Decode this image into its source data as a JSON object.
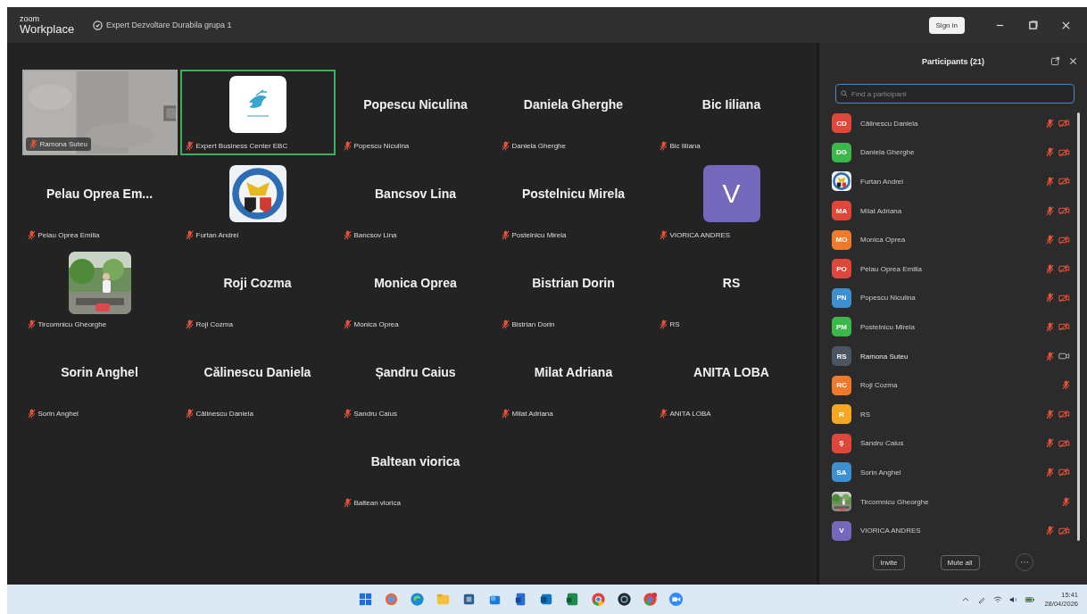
{
  "window": {
    "brand_top": "zoom",
    "brand": "Workplace",
    "title": "Expert Dezvoltare Durabila grupa 1",
    "sign_in": "Sign in"
  },
  "gallery": [
    {
      "kind": "video",
      "label": "Ramona Suteu",
      "muted": true,
      "active": false
    },
    {
      "kind": "logo",
      "label": "Expert Business Center EBC",
      "muted": true,
      "active": true
    },
    {
      "kind": "name",
      "name": "Popescu Niculina",
      "label": "Popescu Niculina",
      "muted": true,
      "active": false
    },
    {
      "kind": "name",
      "name": "Daniela Gherghe",
      "label": "Daniela Gherghe",
      "muted": true,
      "active": false
    },
    {
      "kind": "name",
      "name": "Bic Iiliana",
      "label": "Bic Iiliana",
      "muted": true,
      "active": false
    },
    {
      "kind": "name",
      "name": "Pelau  Oprea  Em...",
      "label": "Pelau Oprea Emilia",
      "muted": true,
      "active": false
    },
    {
      "kind": "crest",
      "label": "Furtan Andrei",
      "muted": true,
      "active": false
    },
    {
      "kind": "name",
      "name": "Bancsov  Lina",
      "label": "Bancsov  Lina",
      "muted": true,
      "active": false
    },
    {
      "kind": "name",
      "name": "Postelnicu Mirela",
      "label": "Postelnicu Mirela",
      "muted": true,
      "active": false
    },
    {
      "kind": "initial",
      "initial": "V",
      "color": "#7468bd",
      "label": "VIORICA ANDRES",
      "muted": true,
      "active": false
    },
    {
      "label": "Tircomnicu Gheorghe",
      "muted": true,
      "active": false
    },
    {
      "kind": "name",
      "name": "Roji Cozma",
      "label": "Roji Cozma",
      "muted": true,
      "active": false
    },
    {
      "kind": "name",
      "name": "Monica Oprea",
      "label": "Monica Oprea",
      "muted": true,
      "active": false
    },
    {
      "kind": "name",
      "name": "Bistrian Dorin",
      "label": "Bistrian Dorin",
      "muted": true,
      "active": false
    },
    {
      "kind": "name",
      "name": "RS",
      "label": "RS",
      "muted": true,
      "active": false
    },
    {
      "kind": "name",
      "name": "Sorin  Anghel",
      "label": "Sorin  Anghel",
      "muted": true,
      "active": false
    },
    {
      "kind": "name",
      "name": "Călinescu Daniela",
      "label": "Călinescu Daniela",
      "muted": true,
      "active": false
    },
    {
      "kind": "name",
      "name": "Șandru Caius",
      "label": "Șandru Caius",
      "muted": true,
      "active": false
    },
    {
      "kind": "name",
      "name": "Milat Adriana",
      "label": "Milat Adriana",
      "muted": true,
      "active": false
    },
    {
      "kind": "name",
      "name": "ANITA LOBA",
      "label": "ANITA LOBA",
      "muted": true,
      "active": false
    },
    {
      "kind": "name",
      "name": "Baltean viorica",
      "label": "Baltean viorica",
      "muted": true,
      "active": false
    }
  ],
  "participants": {
    "title": "Participants (21)",
    "search_placeholder": "Find a participant",
    "items": [
      {
        "kind": "initials",
        "initials": "CD",
        "color": "#e0473b",
        "name": "Călinescu Daniela",
        "muted": true,
        "video_icon": true,
        "video": false
      },
      {
        "kind": "initials",
        "initials": "DG",
        "color": "#3cb84a",
        "name": "Daniela Gherghe",
        "muted": true,
        "video_icon": true,
        "video": false
      },
      {
        "kind": "crest",
        "name": "Furtan Andrei",
        "muted": true,
        "video_icon": true,
        "video": false
      },
      {
        "kind": "initials",
        "initials": "MA",
        "color": "#e0473b",
        "name": "Milat Adriana",
        "muted": true,
        "video_icon": true,
        "video": false
      },
      {
        "kind": "initials",
        "initials": "MO",
        "color": "#f07a2c",
        "name": "Monica Oprea",
        "muted": true,
        "video_icon": true,
        "video": false
      },
      {
        "kind": "initials",
        "initials": "PO",
        "color": "#e0473b",
        "name": "Pelau Oprea Emilia",
        "muted": true,
        "video_icon": true,
        "video": false
      },
      {
        "kind": "initials",
        "initials": "PN",
        "color": "#3d8fd0",
        "name": "Popescu Niculina",
        "muted": true,
        "video_icon": true,
        "video": false
      },
      {
        "kind": "initials",
        "initials": "PM",
        "color": "#3cb84a",
        "name": "Postelnicu Mirela",
        "muted": true,
        "video_icon": true,
        "video": false
      },
      {
        "kind": "initials",
        "initials": "RS",
        "color": "#4b5663",
        "name": "Ramona Suteu",
        "muted": true,
        "video_icon": true,
        "video": true
      },
      {
        "kind": "initials",
        "initials": "RC",
        "color": "#f07a2c",
        "name": "Roji Cozma",
        "muted": true,
        "video_icon": false,
        "video": false
      },
      {
        "kind": "initials",
        "initials": "R",
        "color": "#f5a623",
        "name": "RS",
        "muted": true,
        "video_icon": true,
        "video": false
      },
      {
        "kind": "initials",
        "initials": "Ș",
        "color": "#e0473b",
        "name": "Sandru Caius",
        "muted": true,
        "video_icon": true,
        "video": false
      },
      {
        "kind": "initials",
        "initials": "SA",
        "color": "#3d8fd0",
        "name": "Sorin  Anghel",
        "muted": true,
        "video_icon": true,
        "video": false
      },
      {
        "name": "Tircomnicu Gheorghe",
        "muted": true,
        "video_icon": false,
        "video": false
      },
      {
        "kind": "initials",
        "initials": "V",
        "color": "#7468bd",
        "name": "VIORICA ANDRES",
        "muted": true,
        "video_icon": true,
        "video": false
      }
    ],
    "invite": "Invite",
    "mute_all": "Mute all"
  },
  "taskbar": {
    "time": "15:41",
    "date": "28/04/2026"
  }
}
